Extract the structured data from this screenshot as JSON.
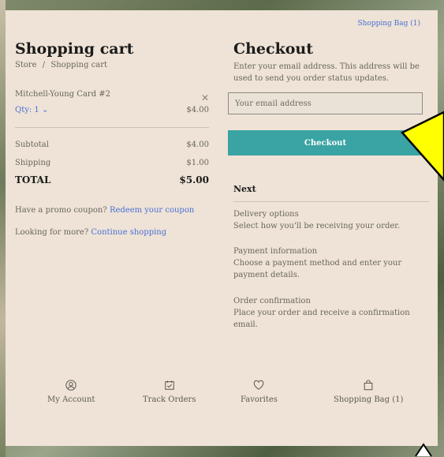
{
  "header": {
    "bag_link": "Shopping Bag (1)"
  },
  "cart": {
    "title": "Shopping cart",
    "breadcrumb": {
      "store": "Store",
      "sep": "/",
      "current": "Shopping cart"
    },
    "item": {
      "name": "Mitchell-Young Card #2",
      "qty": "Qty: 1",
      "price": "$4.00"
    },
    "subtotal": {
      "label": "Subtotal",
      "value": "$4.00"
    },
    "shipping": {
      "label": "Shipping",
      "value": "$1.00"
    },
    "total": {
      "label": "TOTAL",
      "value": "$5.00"
    },
    "promo": {
      "text": "Have a promo coupon?",
      "link": "Redeem your coupon"
    },
    "more": {
      "text": "Looking for more?",
      "link": "Continue shopping"
    }
  },
  "checkout": {
    "title": "Checkout",
    "description": "Enter your email address. This address will be used to send you order status updates.",
    "email_placeholder": "Your email address",
    "button": "Checkout",
    "next_title": "Next",
    "steps": [
      {
        "title": "Delivery options",
        "desc": "Select how you'll be receiving your order."
      },
      {
        "title": "Payment information",
        "desc": "Choose a payment method and enter your payment details."
      },
      {
        "title": "Order confirmation",
        "desc": "Place your order and receive a confirmation email."
      }
    ]
  },
  "nav": [
    {
      "label": "My Account",
      "icon": "user-icon"
    },
    {
      "label": "Track Orders",
      "icon": "track-orders-icon"
    },
    {
      "label": "Favorites",
      "icon": "heart-icon"
    },
    {
      "label": "Shopping Bag (1)",
      "icon": "shopping-bag-icon"
    }
  ],
  "colors": {
    "panel": "#eee3d6",
    "accent": "#3aa3a3",
    "link": "#4a6fd6",
    "arrow": "#ffff00"
  }
}
